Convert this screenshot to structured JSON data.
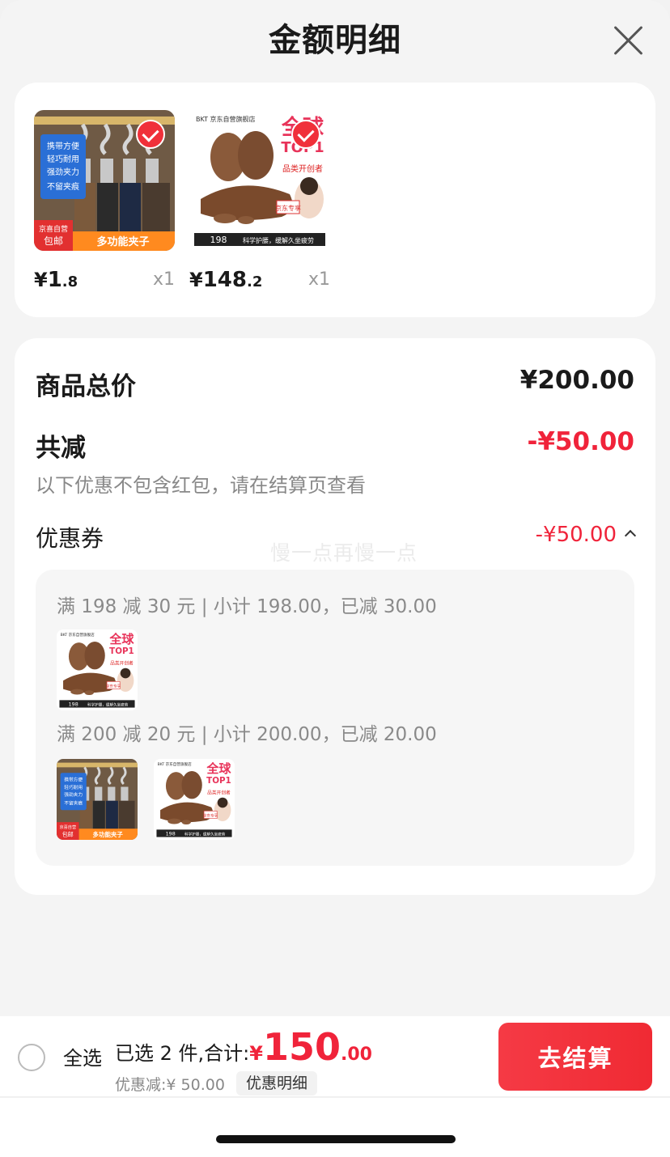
{
  "header": {
    "title": "金额明细"
  },
  "products": [
    {
      "price_currency": "¥",
      "price_int": "1",
      "price_dec": ".8",
      "qty": "x1",
      "image_texts": [
        "携带方便",
        "轻巧耐用",
        "强劲夹力",
        "不留夹痕",
        "京喜自营",
        "包邮",
        "多功能夹子"
      ]
    },
    {
      "price_currency": "¥",
      "price_int": "148",
      "price_dec": ".2",
      "qty": "x1",
      "image_texts": [
        "BKT 京东自营旗舰店",
        "全球",
        "TOP1",
        "品类开创者",
        "京东专享",
        "198",
        "科学护腰，缓解久坐疲劳"
      ]
    }
  ],
  "summary": {
    "goods_total_label": "商品总价",
    "goods_total_value": "¥200.00",
    "discount_label": "共减",
    "discount_value": "-¥50.00",
    "note": "以下优惠不包含红包，请在结算页查看",
    "coupon_label": "优惠券",
    "coupon_value": "-¥50.00",
    "watermark": "慢一点再慢一点"
  },
  "coupon_rules": [
    {
      "text": "满 198 减 30 元 | 小计 198.00，已减 30.00"
    },
    {
      "text": "满 200 减 20 元 | 小计 200.00，已减 20.00"
    }
  ],
  "bottom_bar": {
    "select_all_label": "全选",
    "selected_text": "已选 2 件,合计:",
    "total_currency": "¥",
    "total_int": "150",
    "total_dec": ".00",
    "discount_text": "优惠减:¥ 50.00",
    "detail_tag": "优惠明细",
    "checkout_label": "去结算"
  },
  "colors": {
    "accent_red": "#f0233a",
    "button_red": "#f53a45"
  },
  "icons": [
    "close-icon",
    "check-circle-icon",
    "chevron-up-icon",
    "radio-icon"
  ]
}
